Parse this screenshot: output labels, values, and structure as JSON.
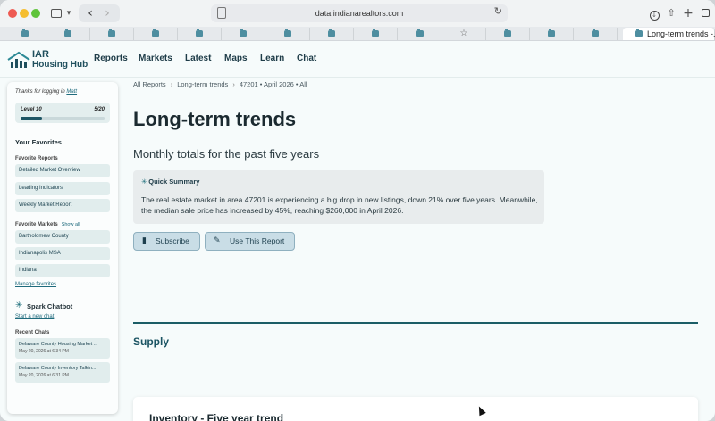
{
  "browser": {
    "url": "data.indianarealtors.com",
    "active_tab_title": "Long-term trends -..."
  },
  "site": {
    "logo_line1": "IAR",
    "logo_line2": "Housing Hub",
    "nav": [
      "Reports",
      "Markets",
      "Latest",
      "Maps",
      "Learn",
      "Chat"
    ]
  },
  "sidebar": {
    "thanks_prefix": "Thanks for logging in",
    "user": "Matt",
    "level_label": "Level 10",
    "level_count": "5/20",
    "level_progress": 0.25,
    "favorites_heading": "Your Favorites",
    "favorite_reports_heading": "Favorite Reports",
    "favorite_reports": [
      "Detailed Market Overview",
      "Leading Indicators",
      "Weekly Market Report"
    ],
    "favorite_markets_heading": "Favorite Markets",
    "show_all": "Show all",
    "favorite_markets": [
      "Bartholomew County",
      "Indianapolis MSA",
      "Indiana"
    ],
    "manage_favorites": "Manage favorites",
    "chatbot_heading": "Spark Chatbot",
    "start_chat": "Start a new chat",
    "recent_chats_heading": "Recent Chats",
    "recent_chats": [
      {
        "title": "Delaware County Housing Market ...",
        "date": "May 20, 2026 at 6:34 PM"
      },
      {
        "title": "Delaware County Inventory Talkin...",
        "date": "May 20, 2026 at 6:31 PM"
      }
    ]
  },
  "main": {
    "breadcrumb": [
      "All Reports",
      "Long-term trends",
      "47201 • April 2026 • All"
    ],
    "title": "Long-term trends",
    "subtitle": "Monthly totals for the past five years",
    "summary_heading": "Quick Summary",
    "summary_text": "The real estate market in area 47201 is experiencing a big drop in new listings, down 21% over five years. Meanwhile, the median sale price has increased by 45%, reaching $260,000 in April 2026.",
    "subscribe_label": "Subscribe",
    "use_report_label": "Use This Report",
    "section_title": "Supply",
    "card_title": "Inventory - Five year trend"
  },
  "icons": {
    "summary": "sparkle-icon",
    "subscribe": "document-icon",
    "use_report": "magic-wand-icon",
    "chatbot": "asterisk-icon"
  },
  "colors": {
    "brand_dark": "#1b5463",
    "divider": "#1b5d66",
    "button_bg": "#c9dde6"
  }
}
